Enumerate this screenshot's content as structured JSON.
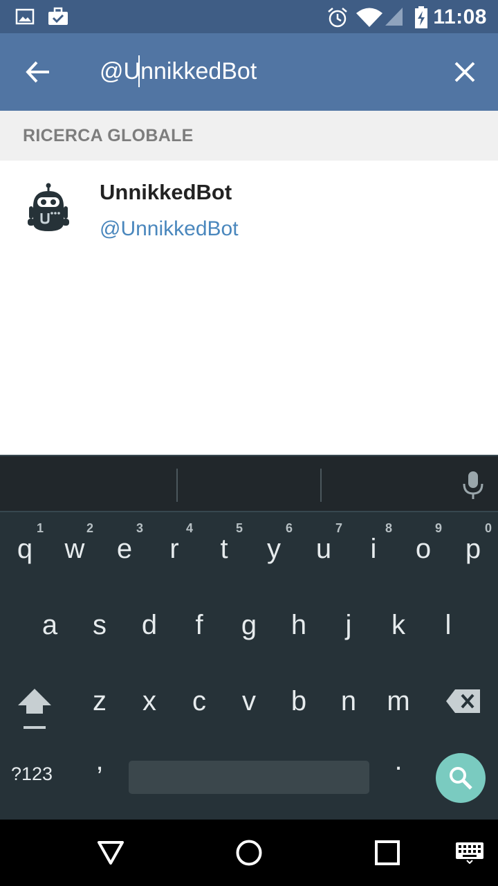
{
  "status_bar": {
    "time": "11:08",
    "icons": [
      "image-icon",
      "briefcase-check-icon",
      "alarm-icon",
      "wifi-icon",
      "cell-signal-icon",
      "battery-charging-icon"
    ]
  },
  "search_bar": {
    "query": "@UnnikkedBot",
    "back_icon": "arrow-left-icon",
    "clear_icon": "close-icon"
  },
  "section": {
    "title": "RICERCA GLOBALE"
  },
  "results": [
    {
      "name": "UnnikkedBot",
      "handle": "@UnnikkedBot",
      "avatar": "robot-avatar-icon"
    }
  ],
  "keyboard": {
    "row1": [
      {
        "key": "q",
        "hint": "1"
      },
      {
        "key": "w",
        "hint": "2"
      },
      {
        "key": "e",
        "hint": "3"
      },
      {
        "key": "r",
        "hint": "4"
      },
      {
        "key": "t",
        "hint": "5"
      },
      {
        "key": "y",
        "hint": "6"
      },
      {
        "key": "u",
        "hint": "7"
      },
      {
        "key": "i",
        "hint": "8"
      },
      {
        "key": "o",
        "hint": "9"
      },
      {
        "key": "p",
        "hint": "0"
      }
    ],
    "row2": [
      "a",
      "s",
      "d",
      "f",
      "g",
      "h",
      "j",
      "k",
      "l"
    ],
    "row3": [
      "z",
      "x",
      "c",
      "v",
      "b",
      "n",
      "m"
    ],
    "symbols_label": "?123",
    "comma": ",",
    "period": "."
  },
  "nav_bar": {
    "icons": [
      "back-triangle-icon",
      "home-circle-icon",
      "recents-square-icon",
      "keyboard-switch-icon"
    ]
  },
  "colors": {
    "status_bar": "#3f5d85",
    "action_bar": "#5175a3",
    "handle_link": "#4a87bd",
    "keyboard_bg": "#263238",
    "search_key": "#7acbc0"
  }
}
